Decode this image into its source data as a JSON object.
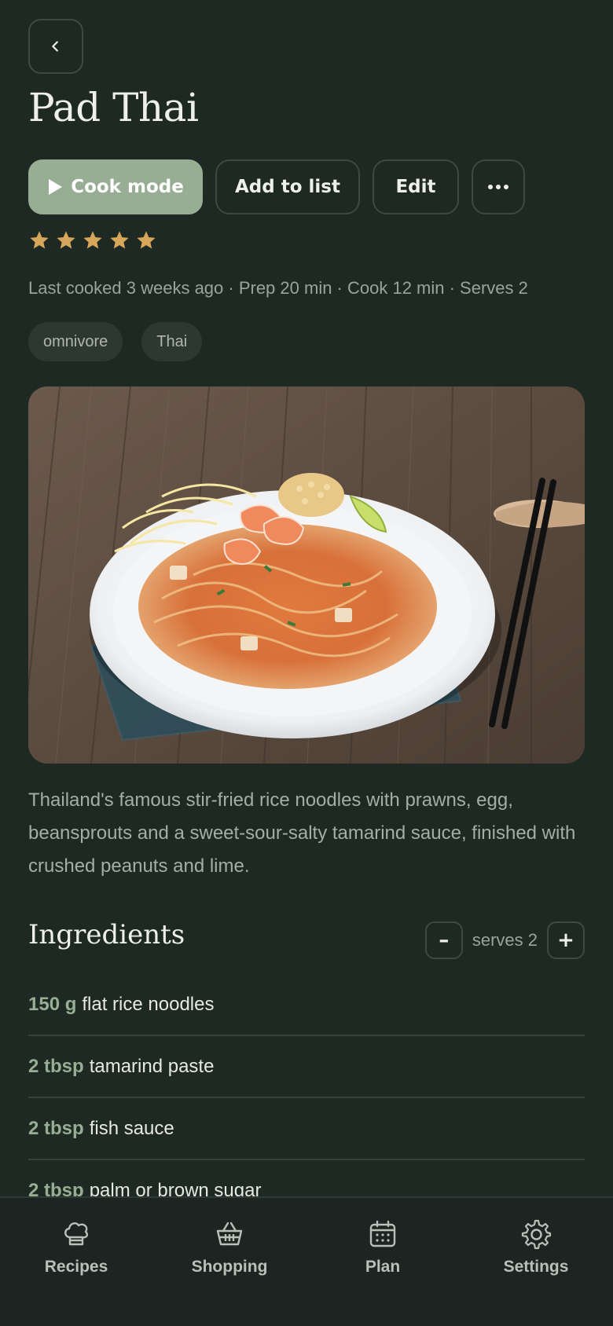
{
  "header": {
    "back_icon": "chevron-left-icon",
    "title": "Pad Thai"
  },
  "actions": {
    "cook_mode": "Cook mode",
    "add_to_list": "Add to list",
    "edit": "Edit",
    "more_icon": "ellipsis-icon"
  },
  "rating": {
    "value": 5,
    "max": 5,
    "color": "#d6a65a"
  },
  "meta": "Last cooked 3 weeks ago · Prep 20 min · Cook 12 min · Serves 2",
  "tags": [
    "omnivore",
    "Thai"
  ],
  "description": "Thailand's famous stir-fried rice noodles with prawns, egg, beansprouts and a sweet-sour-salty tamarind sauce, finished with crushed peanuts and lime.",
  "ingredients": {
    "title": "Ingredients",
    "decrement": "–",
    "increment": "+",
    "serves_label": "serves 2",
    "items": [
      {
        "qty": "150 g",
        "name": "flat rice noodles"
      },
      {
        "qty": "2 tbsp",
        "name": "tamarind paste"
      },
      {
        "qty": "2 tbsp",
        "name": "fish sauce"
      },
      {
        "qty": "2 tbsp",
        "name": "palm or brown sugar"
      }
    ]
  },
  "tabbar": {
    "items": [
      {
        "label": "Recipes",
        "icon": "chef-hat-icon"
      },
      {
        "label": "Shopping",
        "icon": "basket-icon"
      },
      {
        "label": "Plan",
        "icon": "calendar-icon"
      },
      {
        "label": "Settings",
        "icon": "gear-icon"
      }
    ]
  },
  "colors": {
    "background": "#1f2924",
    "accent": "#98ae94",
    "star": "#d6a65a"
  }
}
